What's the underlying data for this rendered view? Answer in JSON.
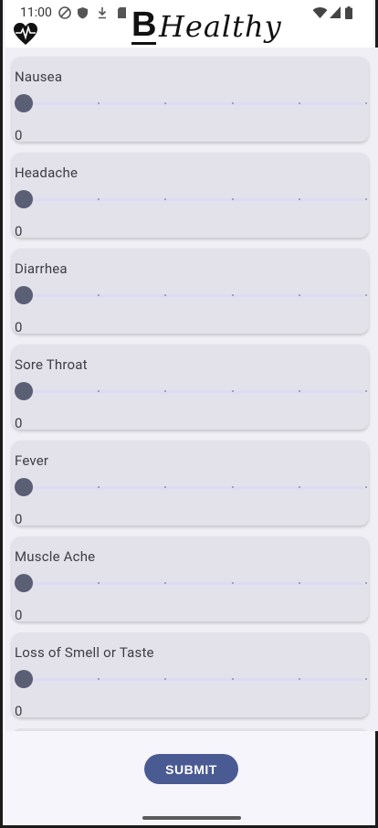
{
  "status": {
    "time": "11:00"
  },
  "brand": {
    "letter": "B",
    "word": "Healthy"
  },
  "symptoms": [
    {
      "label": "Nausea",
      "value": "0"
    },
    {
      "label": "Headache",
      "value": "0"
    },
    {
      "label": "Diarrhea",
      "value": "0"
    },
    {
      "label": "Sore Throat",
      "value": "0"
    },
    {
      "label": "Fever",
      "value": "0"
    },
    {
      "label": "Muscle Ache",
      "value": "0"
    },
    {
      "label": "Loss of Smell or Taste",
      "value": "0"
    }
  ],
  "submit_label": "SUBMIT",
  "colors": {
    "accent": "#4a5a92",
    "thumb": "#5a5f75",
    "card": "#e3e2ea"
  }
}
